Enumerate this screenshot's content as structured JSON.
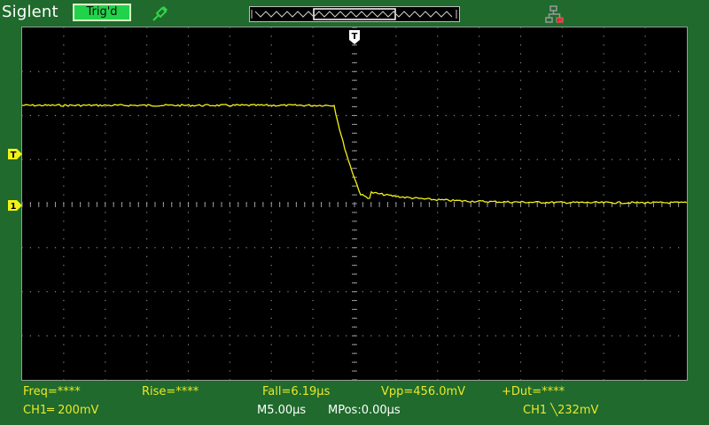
{
  "header": {
    "brand": "Siglent",
    "trigger_status": "Trig'd"
  },
  "icons": {
    "probe": "probe-icon",
    "network": "network-disconnected-icon",
    "trigger_time_marker": "T",
    "trigger_level_marker": "T",
    "channel_marker": "1"
  },
  "measurements": {
    "freq": "Freq=****",
    "rise": "Rise=****",
    "fall": "Fall=6.19µs",
    "vpp": "Vpp=456.0mV",
    "duty": "+Dut=****"
  },
  "status": {
    "ch1_scale": "CH1═ 200mV",
    "timebase": "M5.00µs",
    "mpos": "MPos:0.00µs",
    "trigger": "CH1 ╲232mV"
  },
  "colors": {
    "background": "#1f6a2c",
    "trace": "#f2f21a",
    "trigger_button": "#22d24a",
    "screen": "#000000"
  }
}
